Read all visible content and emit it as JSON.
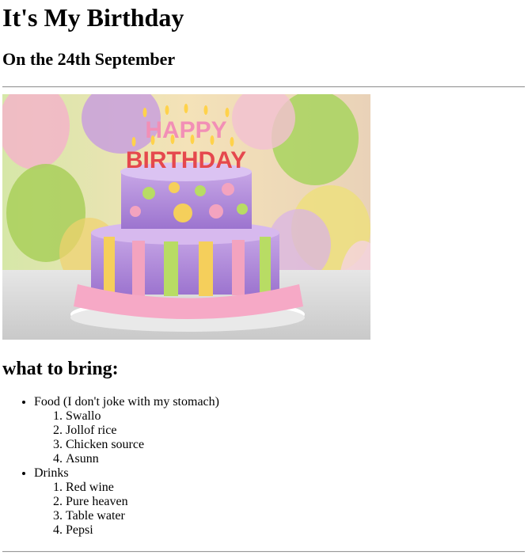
{
  "title": "It's My Birthday",
  "date_line": "On the 24th September",
  "image": {
    "icon": "birthday-cake-photo",
    "text": "HAPPY BIRTHDAY"
  },
  "section_heading": "what to bring:",
  "groups": [
    {
      "label": "Food (I don't joke with my stomach)",
      "items": [
        "Swallo",
        "Jollof rice",
        "Chicken source",
        "Asunn"
      ]
    },
    {
      "label": "Drinks",
      "items": [
        "Red wine",
        "Pure heaven",
        "Table water",
        "Pepsi"
      ]
    }
  ],
  "colors": {
    "text": "#000000",
    "background": "#ffffff",
    "rule": "#9a9a9a"
  }
}
